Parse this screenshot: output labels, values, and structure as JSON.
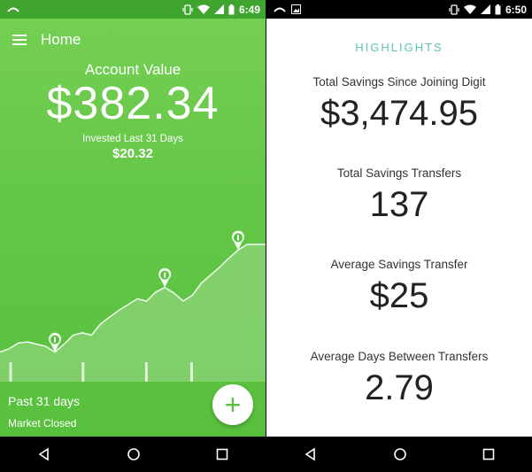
{
  "left_screen": {
    "status": {
      "time": "6:49"
    },
    "header": {
      "title": "Home"
    },
    "account": {
      "label": "Account Value",
      "value": "$382.34",
      "invested_label": "Invested Last 31 Days",
      "invested_value": "$20.32"
    },
    "period_label": "Past 31 days",
    "market_status": "Market Closed",
    "fab_label": "+"
  },
  "right_screen": {
    "status": {
      "time": "6:50"
    },
    "highlights_title": "HIGHLIGHTS",
    "stats": [
      {
        "label": "Total Savings Since Joining Digit",
        "value": "$3,474.95"
      },
      {
        "label": "Total Savings Transfers",
        "value": "137"
      },
      {
        "label": "Average Savings Transfer",
        "value": "$25"
      },
      {
        "label": "Average Days Between Transfers",
        "value": "2.79"
      }
    ]
  },
  "chart_data": {
    "type": "area",
    "points": [
      0.05,
      0.08,
      0.13,
      0.14,
      0.12,
      0.1,
      0.05,
      0.12,
      0.2,
      0.22,
      0.2,
      0.3,
      0.36,
      0.42,
      0.47,
      0.52,
      0.5,
      0.58,
      0.62,
      0.57,
      0.5,
      0.55,
      0.66,
      0.73,
      0.8,
      0.88,
      0.95,
      1.0,
      1.0,
      1.0
    ],
    "markers": [
      {
        "index": 6,
        "icon": "dollar-pin-icon"
      },
      {
        "index": 18,
        "icon": "dollar-pin-icon"
      },
      {
        "index": 26,
        "icon": "dollar-pin-icon"
      }
    ],
    "ticks": [
      1,
      0,
      0,
      0,
      0,
      0,
      0,
      0,
      1,
      0,
      0,
      0,
      0,
      0,
      0,
      1,
      0,
      0,
      0,
      0,
      1,
      0,
      0,
      0,
      0,
      0,
      0,
      0
    ]
  },
  "colors": {
    "green_top": "#74cf52",
    "green_bottom": "#58c03d",
    "accent_teal": "#5bc6b7"
  }
}
